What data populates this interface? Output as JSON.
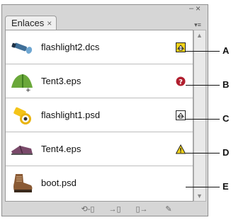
{
  "panel": {
    "tab_label": "Enlaces",
    "tab_close": "×",
    "minimize_glyph": "–",
    "close_glyph": "×",
    "menu_glyph": "▾≡"
  },
  "links": [
    {
      "name": "flashlight2.dcs",
      "thumb": "flashlight-blue-icon",
      "status": "modified-icon",
      "callout": "A"
    },
    {
      "name": "Tent3.eps",
      "thumb": "tent-green-icon",
      "status": "missing-icon",
      "callout": "B"
    },
    {
      "name": "flashlight1.psd",
      "thumb": "flashlight-yellow-icon",
      "status": "modified-outline-icon",
      "callout": "C"
    },
    {
      "name": "Tent4.eps",
      "thumb": "tent-purple-icon",
      "status": "warning-icon",
      "callout": "D"
    },
    {
      "name": "boot.psd",
      "thumb": "boot-icon",
      "status": "",
      "callout": "E"
    }
  ],
  "toolbar": {
    "relink": "⟲‑▯",
    "goto": "→▯",
    "update": "▯→",
    "edit": "✎"
  },
  "colors": {
    "panel_bg": "#d6d6d6",
    "missing_red": "#b01e2e",
    "warning_yellow": "#f2d21a"
  }
}
